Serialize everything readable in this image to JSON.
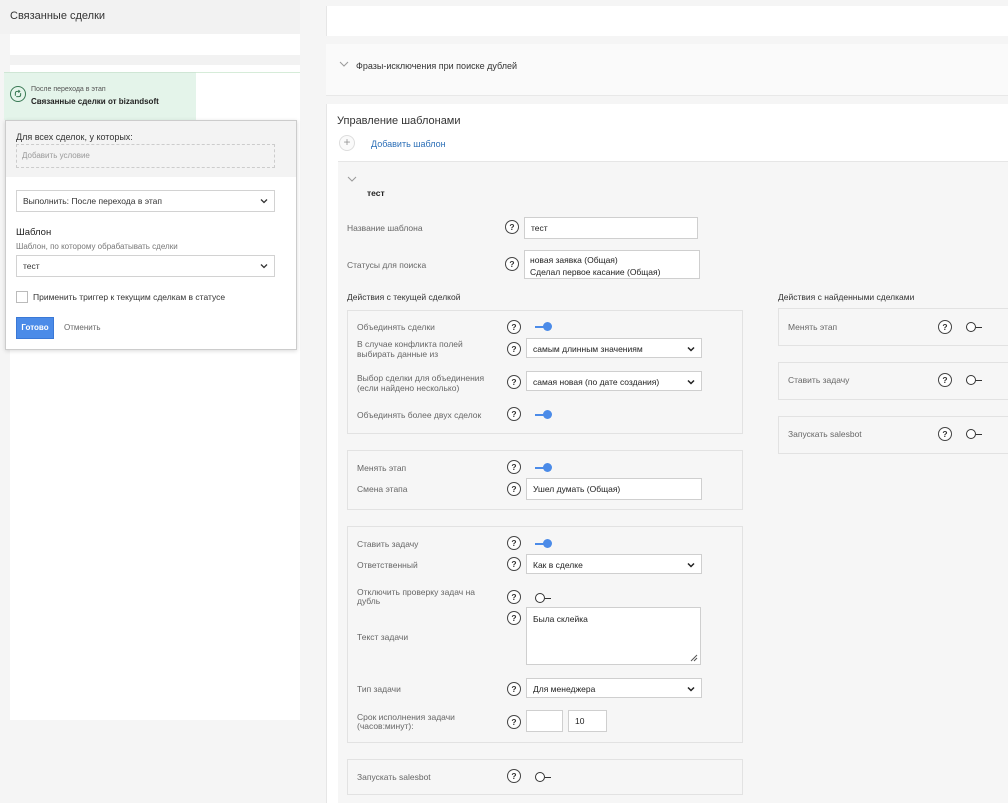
{
  "left": {
    "title": "Связанные сделки",
    "stage_card": {
      "sub": "После перехода в этап",
      "name": "Связанные сделки от bizandsoft"
    },
    "popup": {
      "condition_label": "Для всех сделок, у которых:",
      "condition_placeholder": "Добавить условие",
      "execute_value": "Выполнить: После перехода в этап",
      "template_heading": "Шаблон",
      "template_hint": "Шаблон, по которому обрабатывать сделки",
      "template_value": "тест",
      "apply_checkbox_label": "Применить триггер к текущим сделкам в статусе",
      "apply_checked": false,
      "done_label": "Готово",
      "cancel_label": "Отменить"
    }
  },
  "right": {
    "phrases_label": "Фразы-исключения при поиске дублей",
    "templates_title": "Управление шаблонами",
    "add_template_label": "Добавить шаблон",
    "template": {
      "name": "тест",
      "name_label": "Название шаблона",
      "name_value": "тест",
      "statuses_label": "Статусы для поиска",
      "statuses": [
        "новая заявка (Общая)",
        "Сделал первое касание (Общая)"
      ],
      "current_heading": "Действия с текущей сделкой",
      "found_heading": "Действия с найденными сделками",
      "merge": {
        "merge_label": "Объединять сделки",
        "merge_on": true,
        "conflict_label": "В случае конфликта полей выбирать данные из",
        "conflict_value": "самым длинным значениям",
        "choose_label": "Выбор сделки для объединения (если найдено несколько)",
        "choose_value": "самая новая (по дате создания)",
        "more_two_label": "Объединять более двух сделок",
        "more_two_on": true
      },
      "stage": {
        "change_label": "Менять этап",
        "change_on": true,
        "new_stage_label": "Смена этапа",
        "new_stage_value": "Ушел думать (Общая)"
      },
      "task": {
        "set_label": "Ставить задачу",
        "set_on": true,
        "responsible_label": "Ответственный",
        "responsible_value": "Как в сделке",
        "disable_check_label": "Отключить проверку задач на дубль",
        "disable_check_on": false,
        "text_label": "Текст задачи",
        "text_value": "Была склейка",
        "type_label": "Тип задачи",
        "type_value": "Для менеджера",
        "deadline_label": "Срок исполнения задачи (часов:минут):",
        "deadline_hours": "",
        "deadline_minutes": "10"
      },
      "salesbot": {
        "label": "Запускать salesbot",
        "on": false
      },
      "found": {
        "change_stage_label": "Менять этап",
        "change_stage_on": false,
        "set_task_label": "Ставить задачу",
        "set_task_on": false,
        "salesbot_label": "Запускать salesbot",
        "salesbot_on": false
      }
    },
    "help_glyph": "?"
  }
}
